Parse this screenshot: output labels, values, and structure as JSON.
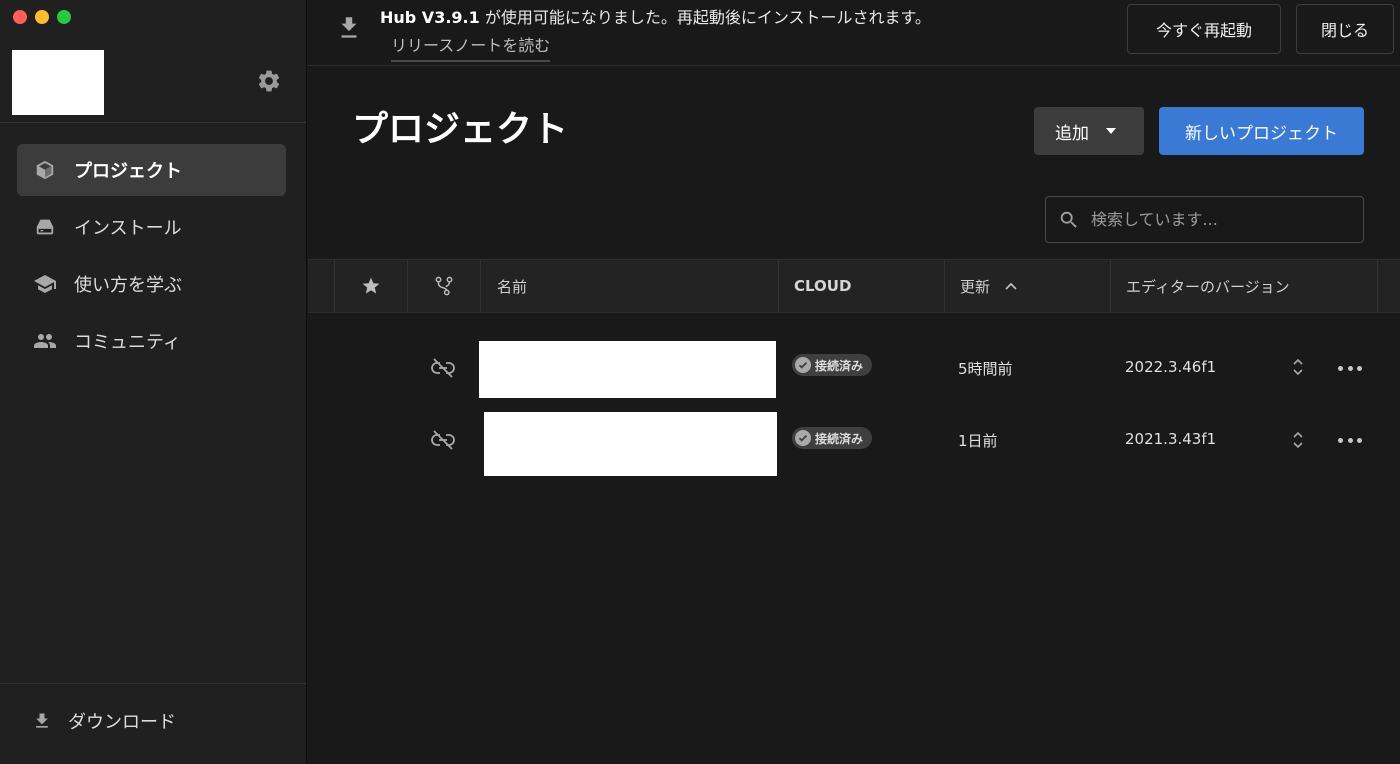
{
  "sidebar": {
    "settings_icon": "gear-icon",
    "nav": [
      {
        "label": "プロジェクト",
        "icon": "cube-icon",
        "active": true
      },
      {
        "label": "インストール",
        "icon": "drive-icon",
        "active": false
      },
      {
        "label": "使い方を学ぶ",
        "icon": "graduation-cap-icon",
        "active": false
      },
      {
        "label": "コミュニティ",
        "icon": "people-icon",
        "active": false
      }
    ],
    "download_label": "ダウンロード"
  },
  "banner": {
    "version": "Hub V3.9.1",
    "message": " が使用可能になりました。再起動後にインストールされます。",
    "release_notes": "リリースノートを読む",
    "restart_label": "今すぐ再起動",
    "close_label": "閉じる"
  },
  "main": {
    "title": "プロジェクト",
    "add_label": "追加",
    "new_project_label": "新しいプロジェクト",
    "search_placeholder": "検索しています..."
  },
  "table": {
    "headers": {
      "name": "名前",
      "cloud": "CLOUD",
      "updated": "更新",
      "editor_version": "エディターのバージョン"
    },
    "sort": {
      "column": "updated",
      "direction": "ascending"
    },
    "rows": [
      {
        "cloud_status": "接続済み",
        "updated": "5時間前",
        "editor_version": "2022.3.46f1"
      },
      {
        "cloud_status": "接続済み",
        "updated": "1日前",
        "editor_version": "2021.3.43f1"
      }
    ]
  },
  "colors": {
    "accent": "#3a79d4",
    "background": "#191919",
    "sidebar": "#202020",
    "badge": "#3f3f3f"
  }
}
